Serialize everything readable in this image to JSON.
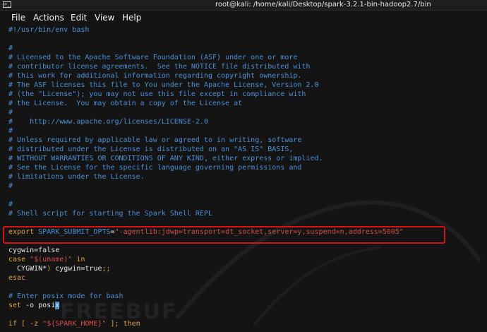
{
  "window": {
    "title": "root@kali: /home/kali/Desktop/spark-3.2.1-bin-hadoop2.7/bin",
    "icon": "terminal-icon"
  },
  "menu": [
    "File",
    "Actions",
    "Edit",
    "View",
    "Help"
  ],
  "watermark": "FREEBUF",
  "lines": [
    [
      {
        "t": "#!/usr/bin/env bash",
        "k": "c"
      }
    ],
    [
      {
        "t": "",
        "k": "plain"
      }
    ],
    [
      {
        "t": "#",
        "k": "c"
      }
    ],
    [
      {
        "t": "# Licensed to the Apache Software Foundation (ASF) under one or more",
        "k": "c"
      }
    ],
    [
      {
        "t": "# contributor license agreements.  See the NOTICE file distributed with",
        "k": "c"
      }
    ],
    [
      {
        "t": "# this work for additional information regarding copyright ownership.",
        "k": "c"
      }
    ],
    [
      {
        "t": "# The ASF licenses this file to You under the Apache License, Version 2.0",
        "k": "c"
      }
    ],
    [
      {
        "t": "# (the \"License\"); you may not use this file except in compliance with",
        "k": "c"
      }
    ],
    [
      {
        "t": "# the License.  You may obtain a copy of the License at",
        "k": "c"
      }
    ],
    [
      {
        "t": "#",
        "k": "c"
      }
    ],
    [
      {
        "t": "#    http://www.apache.org/licenses/LICENSE-2.0",
        "k": "c"
      }
    ],
    [
      {
        "t": "#",
        "k": "c"
      }
    ],
    [
      {
        "t": "# Unless required by applicable law or agreed to in writing, software",
        "k": "c"
      }
    ],
    [
      {
        "t": "# distributed under the License is distributed on an \"AS IS\" BASIS,",
        "k": "c"
      }
    ],
    [
      {
        "t": "# WITHOUT WARRANTIES OR CONDITIONS OF ANY KIND, either express or implied.",
        "k": "c"
      }
    ],
    [
      {
        "t": "# See the License for the specific language governing permissions and",
        "k": "c"
      }
    ],
    [
      {
        "t": "# limitations under the License.",
        "k": "c"
      }
    ],
    [
      {
        "t": "#",
        "k": "c"
      }
    ],
    [
      {
        "t": "",
        "k": "plain"
      }
    ],
    [
      {
        "t": "#",
        "k": "c"
      }
    ],
    [
      {
        "t": "# Shell script for starting the Spark Shell REPL",
        "k": "c"
      }
    ],
    [
      {
        "t": "",
        "k": "plain"
      }
    ],
    [
      {
        "t": "export ",
        "k": "kw"
      },
      {
        "t": "SPARK_SUBMIT_OPTS",
        "k": "c"
      },
      {
        "t": "=",
        "k": "plain"
      },
      {
        "t": "\"-agentlib:jdwp=transport=dt_socket,server=y,suspend=n,address=5005\"",
        "k": "str"
      }
    ],
    [
      {
        "t": "",
        "k": "plain"
      }
    ],
    [
      {
        "t": "cygwin",
        "k": "plain"
      },
      {
        "t": "=",
        "k": "plain"
      },
      {
        "t": "false",
        "k": "plain"
      }
    ],
    [
      {
        "t": "case ",
        "k": "kw"
      },
      {
        "t": "\"$(uname)\"",
        "k": "str"
      },
      {
        "t": " in",
        "k": "kw"
      }
    ],
    [
      {
        "t": "  CYGWIN*",
        "k": "plain"
      },
      {
        "t": ")",
        "k": "kw"
      },
      {
        "t": " cygwin",
        "k": "plain"
      },
      {
        "t": "=",
        "k": "plain"
      },
      {
        "t": "true",
        "k": "plain"
      },
      {
        "t": ";;",
        "k": "kw"
      }
    ],
    [
      {
        "t": "esac",
        "k": "kw"
      }
    ],
    [
      {
        "t": "",
        "k": "plain"
      }
    ],
    [
      {
        "t": "# Enter posix mode for bash",
        "k": "c"
      }
    ],
    [
      {
        "t": "set",
        "k": "kw"
      },
      {
        "t": " -o posi",
        "k": "plain"
      },
      {
        "t": "x",
        "k": "cursor"
      }
    ],
    [
      {
        "t": "",
        "k": "plain"
      }
    ],
    [
      {
        "t": "if [ -z ",
        "k": "kw"
      },
      {
        "t": "\"${SPARK_HOME}\"",
        "k": "str"
      },
      {
        "t": " ]; then",
        "k": "kw"
      }
    ]
  ]
}
